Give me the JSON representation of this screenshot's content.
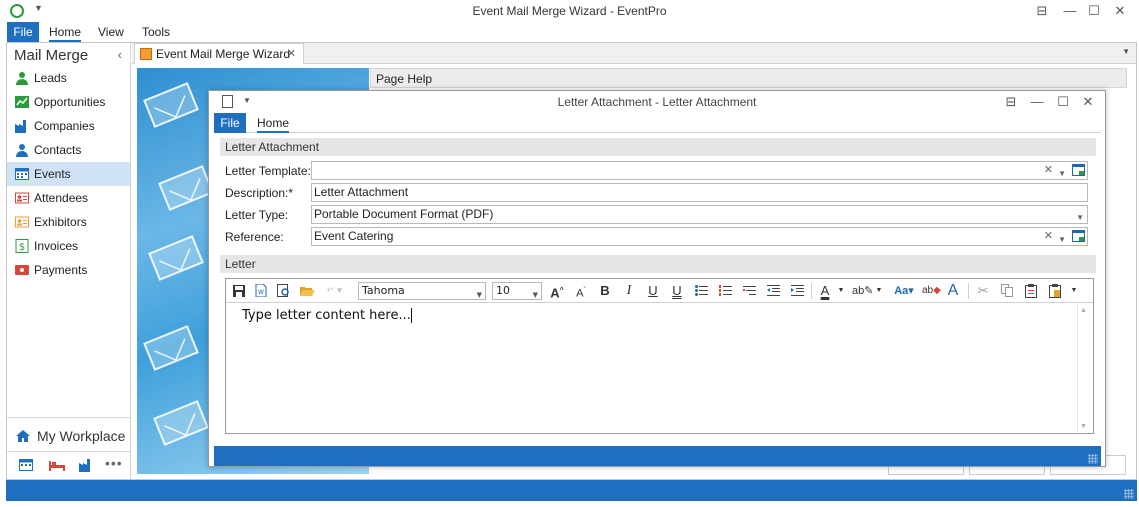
{
  "app": {
    "title": "Event Mail Merge Wizard - EventPro",
    "menu": {
      "file": "File",
      "home": "Home",
      "view": "View",
      "tools": "Tools"
    }
  },
  "sidebar": {
    "title": "Mail Merge",
    "items": [
      {
        "label": "Leads",
        "icon": "person-icon",
        "color": "#2c9a3c"
      },
      {
        "label": "Opportunities",
        "icon": "trend-chart-icon",
        "color": "#2c9a3c"
      },
      {
        "label": "Companies",
        "icon": "factory-icon",
        "color": "#1e6fc0"
      },
      {
        "label": "Contacts",
        "icon": "person-icon",
        "color": "#1e6fc0"
      },
      {
        "label": "Events",
        "icon": "calendar-icon",
        "color": "#1e6fc0"
      },
      {
        "label": "Attendees",
        "icon": "id-card-icon",
        "color": "#d9453b"
      },
      {
        "label": "Exhibitors",
        "icon": "id-card-icon",
        "color": "#f39c37"
      },
      {
        "label": "Invoices",
        "icon": "dollar-icon",
        "color": "#2c9a3c"
      },
      {
        "label": "Payments",
        "icon": "payment-icon",
        "color": "#d9453b"
      }
    ],
    "active_index": 4,
    "workplace": "My Workplace"
  },
  "doc_tab": {
    "label": "Event Mail Merge Wizard"
  },
  "wizard": {
    "page_help": "Page Help"
  },
  "dialog": {
    "title": "Letter Attachment - Letter Attachment",
    "menu": {
      "file": "File",
      "home": "Home"
    },
    "section_attachment": "Letter Attachment",
    "fields": {
      "template_label": "Letter Template:",
      "template_value": "",
      "description_label": "Description:*",
      "description_value": "Letter Attachment",
      "type_label": "Letter Type:",
      "type_value": "Portable Document Format (PDF)",
      "reference_label": "Reference:",
      "reference_value": "Event Catering"
    },
    "section_letter": "Letter",
    "editor": {
      "font": "Tahoma",
      "size": "10",
      "content": "Type letter content here..."
    }
  },
  "colors": {
    "accent": "#1e6fc0",
    "sidebar_active": "#cfe3f4"
  }
}
